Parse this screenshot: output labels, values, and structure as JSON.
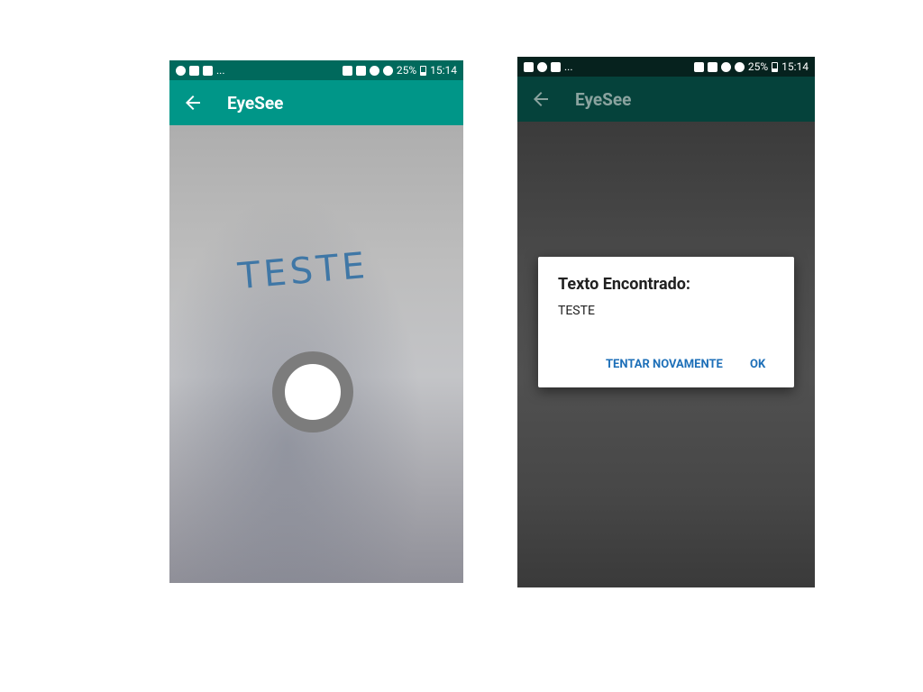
{
  "status_bar": {
    "dots": "...",
    "battery": "25%",
    "time": "15:14"
  },
  "app": {
    "title": "EyeSee"
  },
  "camera": {
    "handwritten_text": "TESTE"
  },
  "dialog": {
    "title": "Texto Encontrado:",
    "message": "TESTE",
    "retry_label": "TENTAR NOVAMENTE",
    "ok_label": "OK"
  },
  "colors": {
    "primary": "#009688",
    "primary_dark": "#00695c",
    "accent": "#1d6fb8"
  }
}
